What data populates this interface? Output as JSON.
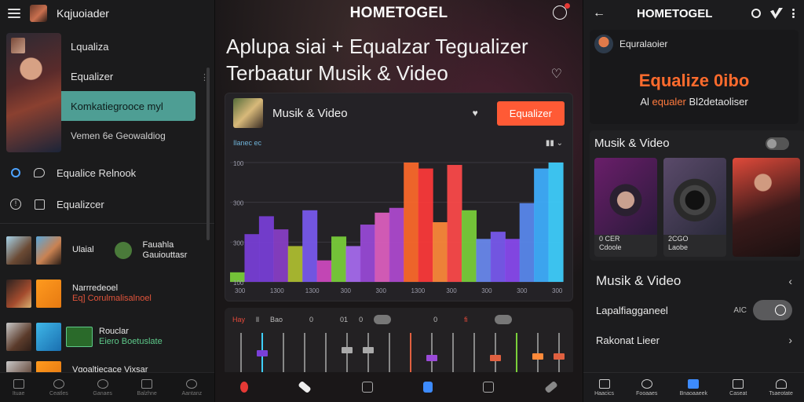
{
  "left": {
    "app_title": "Kqjuoiader",
    "menu": [
      "Lqualiza",
      "Equalizer",
      "Komkatiegrooce myl",
      "Vemen 6e Geowaldiog"
    ],
    "rows": [
      {
        "icon": "circle-icon",
        "label": "Equalice Relnook"
      },
      {
        "icon": "info-icon",
        "label": "Equalizcer"
      }
    ],
    "list": [
      {
        "t1": "Ulaial",
        "t2": "Fauahla",
        "t3": "Gauiouttasr"
      },
      {
        "t1": "Narrredeoel",
        "t2": "Eq] Corulmalisalnoel",
        "t3": ""
      },
      {
        "t1": "Rouclar",
        "t2": "Eiero Boetuslate",
        "t3": ""
      },
      {
        "t1": "Vgoaltiecace Vixsar",
        "t2": "",
        "t3": ""
      }
    ],
    "nav": [
      "Ituae",
      "Ceatles",
      "Ganaes",
      "Balzhne",
      "Aantanz"
    ]
  },
  "center": {
    "brand": "HOMETOGEL",
    "headline_1": "Aplupa siai + Equalzar Tegualizer",
    "headline_2": "Terbaatur Musik & Video",
    "card_title": "Musik & Video",
    "eq_button": "Equalizer",
    "sub_label": "Ilanec ec",
    "mixer_labels": [
      "Hay",
      "ll",
      "Bao",
      "0",
      "01",
      "0",
      "0",
      "fi"
    ]
  },
  "chart_data": {
    "type": "area",
    "y_ticks": [
      "100",
      "300",
      "300",
      "100"
    ],
    "x_ticks": [
      "300",
      "1300",
      "1300",
      "300",
      "300",
      "1300",
      "300",
      "300",
      "300",
      "300"
    ],
    "values": [
      8,
      40,
      55,
      44,
      30,
      60,
      18,
      38,
      30,
      48,
      58,
      62,
      100,
      95,
      50,
      98,
      60,
      36,
      42,
      36,
      66,
      95,
      100
    ],
    "grid": true,
    "legend": "none"
  },
  "right": {
    "brand": "HOMETOGEL",
    "user": "Equralaoier",
    "headline": "Equalize 0ibo",
    "sub_prefix": "Al",
    "sub_orange": "equaler",
    "sub_suffix": "Bl2detaoliser",
    "section1": "Musik & Video",
    "tiles": [
      {
        "cap1": "0 CER",
        "cap2": "Cdoole"
      },
      {
        "cap1": "2CGO",
        "cap2": "Laobe"
      },
      {
        "cap1": "",
        "cap2": ""
      }
    ],
    "section2": "Musik & Video",
    "list": [
      {
        "label": "Lapalfiagganeel",
        "extra": "AIC"
      },
      {
        "label": "Rakonat Lieer",
        "extra": ""
      }
    ],
    "nav": [
      "Haacics",
      "Fooaaes",
      "Bnaoaaeek",
      "Caseat",
      "Tsaeotate"
    ]
  },
  "colors": {
    "accent": "#ff5a35",
    "teal": "#4e9e94",
    "blue": "#3d8bfd"
  }
}
